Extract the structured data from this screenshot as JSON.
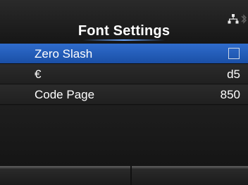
{
  "header": {
    "title": "Font Settings",
    "icons": [
      "network-icon",
      "bluetooth-icon"
    ]
  },
  "settings": {
    "items": [
      {
        "label": "Zero Slash",
        "value": "",
        "control": "checkbox",
        "checked": false,
        "selected": true
      },
      {
        "label": "€",
        "value": "d5",
        "control": "value",
        "selected": false
      },
      {
        "label": "Code Page",
        "value": "850",
        "control": "value",
        "selected": false
      }
    ]
  },
  "footer": {
    "left_label": "",
    "right_label": ""
  },
  "colors": {
    "selection": "#2f6ccc",
    "row": "#2b2b2b",
    "background": "#1a1a1a"
  }
}
